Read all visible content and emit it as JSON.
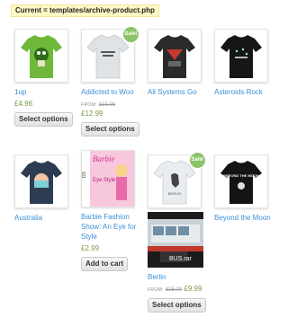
{
  "banner": "Current = templates/archive-product.php",
  "products": [
    {
      "title": "1up",
      "price": "£4.96",
      "button": "Select options"
    },
    {
      "title": "Addicted to Woo",
      "from": "FROM:",
      "old_price": "£15.00",
      "price": "£12.99",
      "button": "Select options",
      "sale": "Sale!"
    },
    {
      "title": "All Systems Go"
    },
    {
      "title": "Asteroids Rock"
    },
    {
      "title": "Australia"
    },
    {
      "title": "Barbie Fashion Show: An Eye for Style",
      "price": "£2.99",
      "button": "Add to cart",
      "box_text": "Barbie",
      "box_sub": "Eye Style"
    },
    {
      "title": "Berlin",
      "from": "FROM:",
      "old_price": "£15.00",
      "price": "£9.99",
      "button": "Select options",
      "sale": "Sale!",
      "tshirt_text": "BERLIN",
      "file_label": "BUS.rar"
    },
    {
      "title": "Beyond the Moon",
      "tshirt_text": "BEYOND THE MOON"
    }
  ],
  "colors": {
    "link": "#3a8fd6",
    "price": "#7a9a45",
    "sale_badge": "#8cc36a",
    "banner_bg": "#fff8c4"
  }
}
